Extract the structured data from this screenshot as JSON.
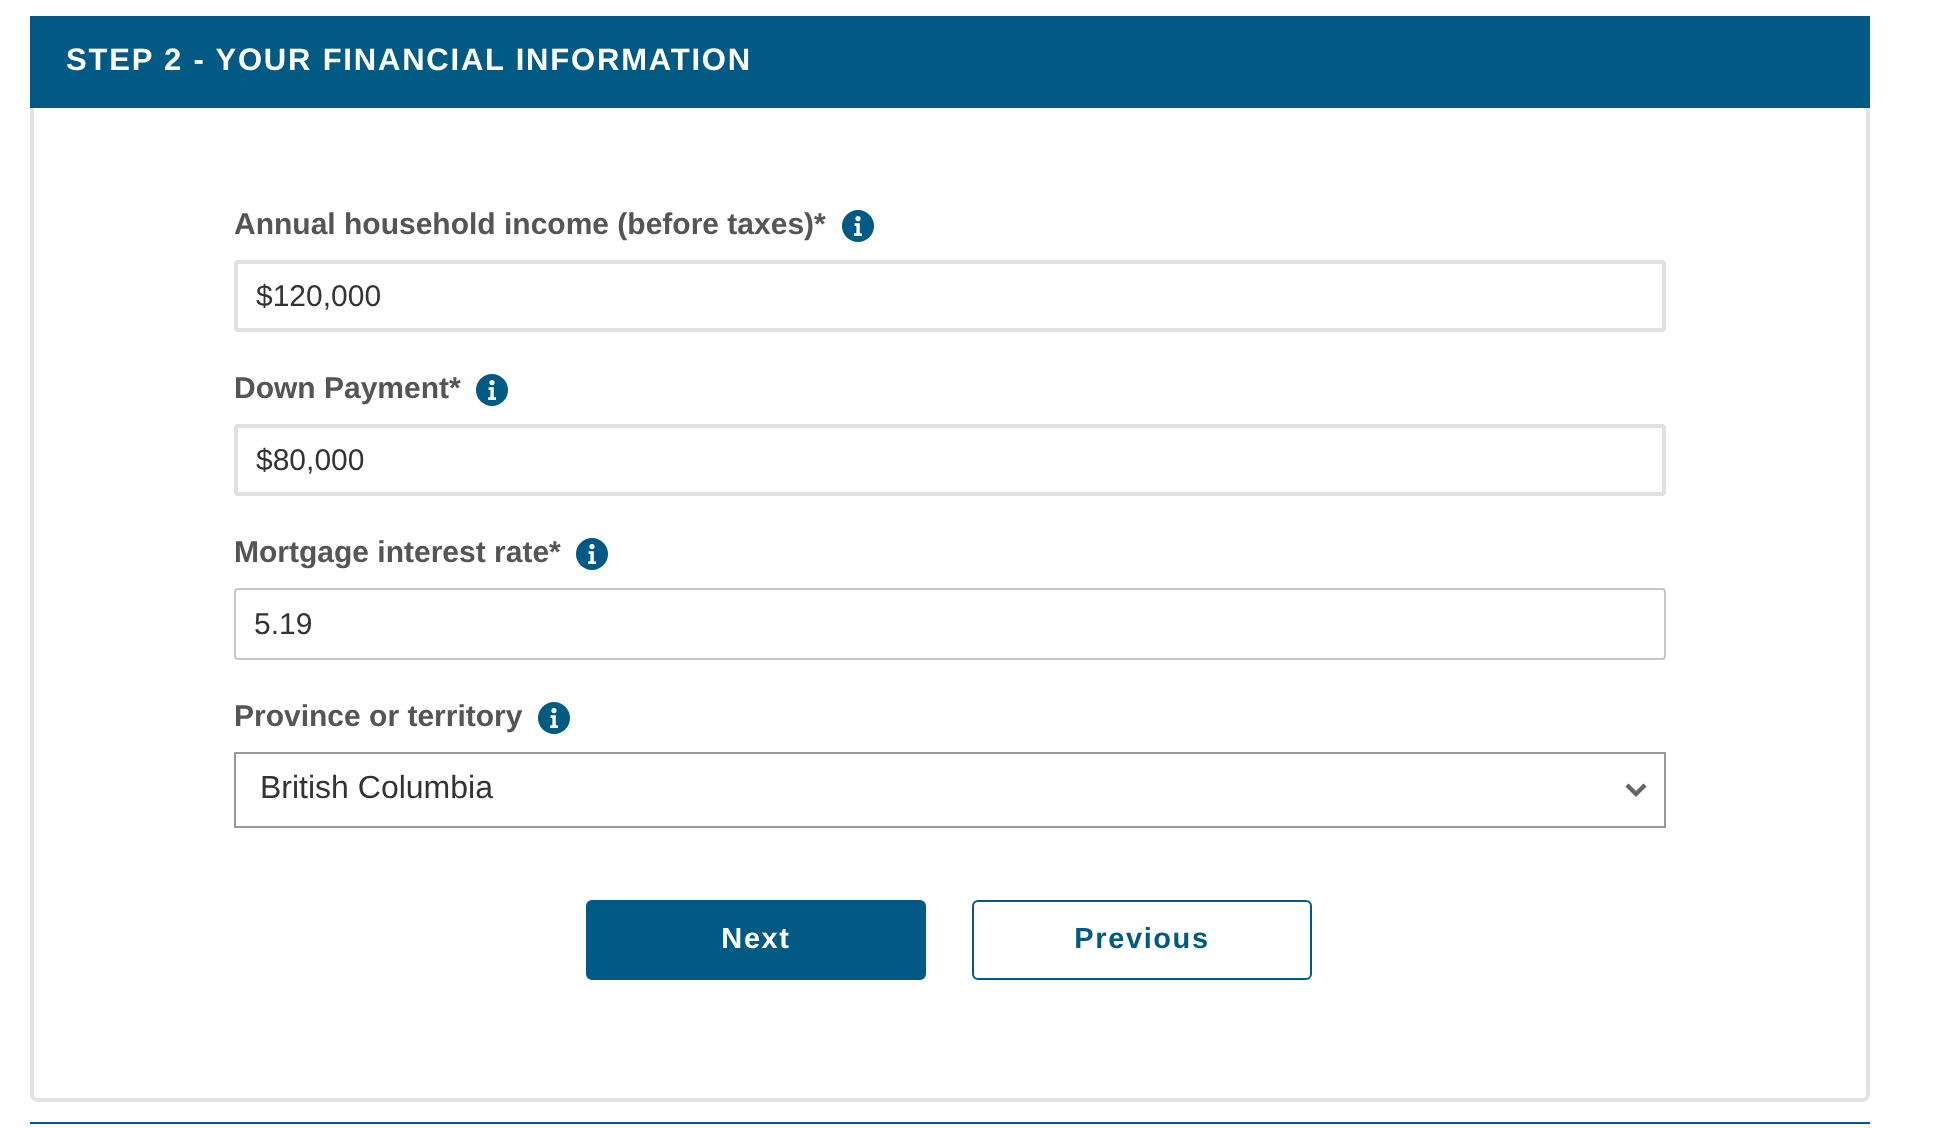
{
  "header": {
    "title": "STEP 2 - YOUR FINANCIAL INFORMATION"
  },
  "fields": [
    {
      "kind": "text",
      "label": "Annual household income (before taxes)*",
      "value": "$120,000"
    },
    {
      "kind": "text",
      "label": "Down Payment*",
      "value": "$80,000"
    },
    {
      "kind": "text",
      "label": "Mortgage interest rate*",
      "value": "5.19"
    },
    {
      "kind": "select",
      "label": "Province or territory",
      "value": "British Columbia"
    }
  ],
  "buttons": [
    {
      "kind": "primary",
      "label": "Next"
    },
    {
      "kind": "secondary",
      "label": "Previous"
    }
  ]
}
